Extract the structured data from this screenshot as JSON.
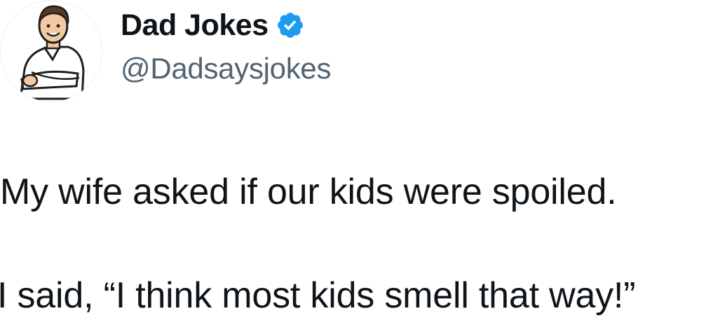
{
  "author": {
    "display_name": "Dad Jokes",
    "handle": "@Dadsaysjokes",
    "verified": true,
    "verified_icon": "verified-badge-icon",
    "verified_color": "#1d9bf0",
    "avatar_icon": "cartoon-man-avatar"
  },
  "tweet": {
    "lines": [
      "My wife asked if our kids were spoiled.",
      "I said, “I think most kids smell that way!”"
    ]
  },
  "colors": {
    "text": "#0f1419",
    "handle": "#536471",
    "background": "#ffffff"
  }
}
